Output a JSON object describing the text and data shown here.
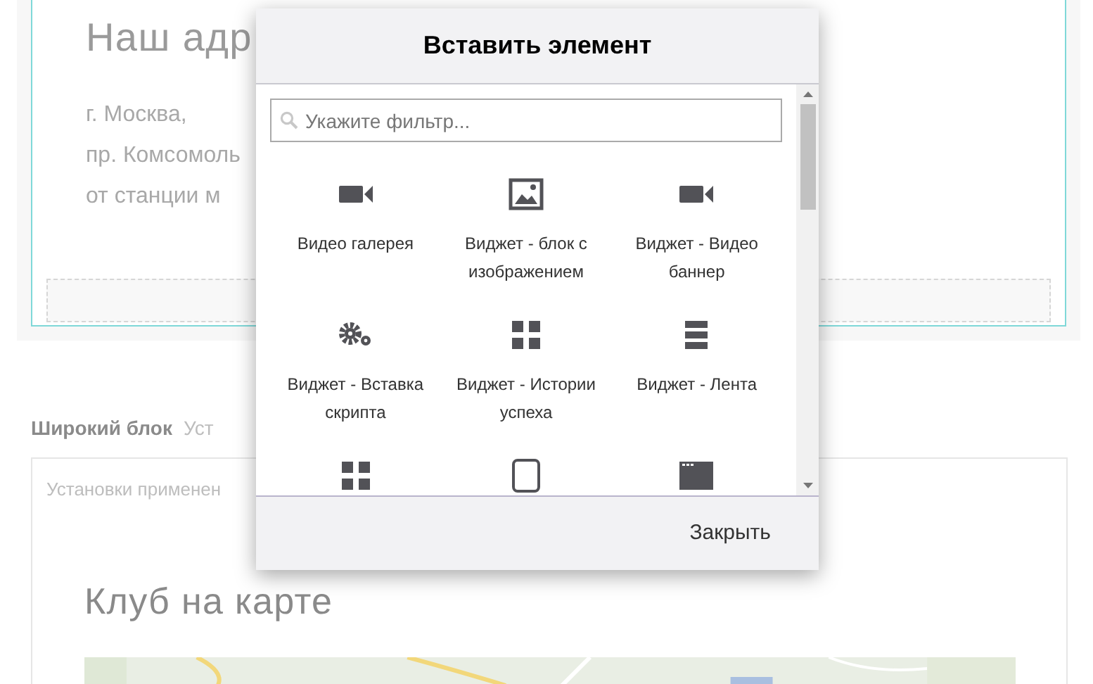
{
  "page": {
    "address_heading": "Наш адр",
    "address_lines": [
      "г. Москва,",
      "пр. Комсомоль",
      "от станции м"
    ],
    "wide_block": {
      "title": "Широкий блок",
      "subtitle": "Уст",
      "note": "Установки применен",
      "map_heading": "Клуб на карте"
    }
  },
  "dialog": {
    "title": "Вставить элемент",
    "search": {
      "placeholder": "Укажите фильтр..."
    },
    "items": [
      {
        "kind": "widget",
        "label": "Видео галерея"
      },
      {
        "kind": "widget",
        "label": "Виджет - блок с изображением"
      },
      {
        "kind": "widget",
        "label": "Виджет - Видео баннер"
      },
      {
        "kind": "widget",
        "label": "Виджет - Вставка скрипта"
      },
      {
        "kind": "widget",
        "label": "Виджет - Истории успеха"
      },
      {
        "kind": "widget",
        "label": "Виджет - Лента"
      },
      {
        "kind": "cut_off"
      },
      {
        "kind": "cut_off"
      },
      {
        "kind": "cut_off"
      }
    ],
    "close_button": "Закрыть"
  }
}
